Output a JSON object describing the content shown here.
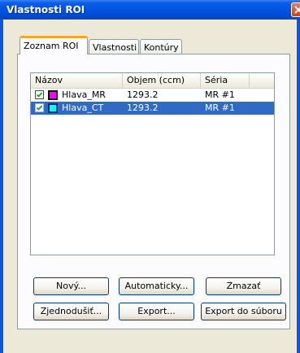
{
  "window": {
    "title": "Vlastnosti ROI"
  },
  "tabs": [
    {
      "label": "Zoznam ROI",
      "active": true
    },
    {
      "label": "Vlastnosti",
      "active": false
    },
    {
      "label": "Kontúry",
      "active": false
    }
  ],
  "list": {
    "columns": [
      "Názov",
      "Objem (ccm)",
      "Séria"
    ],
    "rows": [
      {
        "checked": true,
        "color": "#ff00ff",
        "name": "Hlava_MR",
        "volume": "1293.2",
        "series": "MR #1",
        "selected": false
      },
      {
        "checked": true,
        "color": "#00ffff",
        "name": "Hlava_CT",
        "volume": "1293.2",
        "series": "MR #1",
        "selected": true
      }
    ]
  },
  "buttons": {
    "new": "Nový...",
    "auto": "Automaticky...",
    "delete": "Zmazať",
    "simplify": "Zjednodušiť...",
    "export": "Export...",
    "export_file": "Export do súboru"
  },
  "colors": {
    "titlebar": "#0052e0",
    "selection": "#316ac5",
    "tab_highlight": "#f5a52c"
  }
}
